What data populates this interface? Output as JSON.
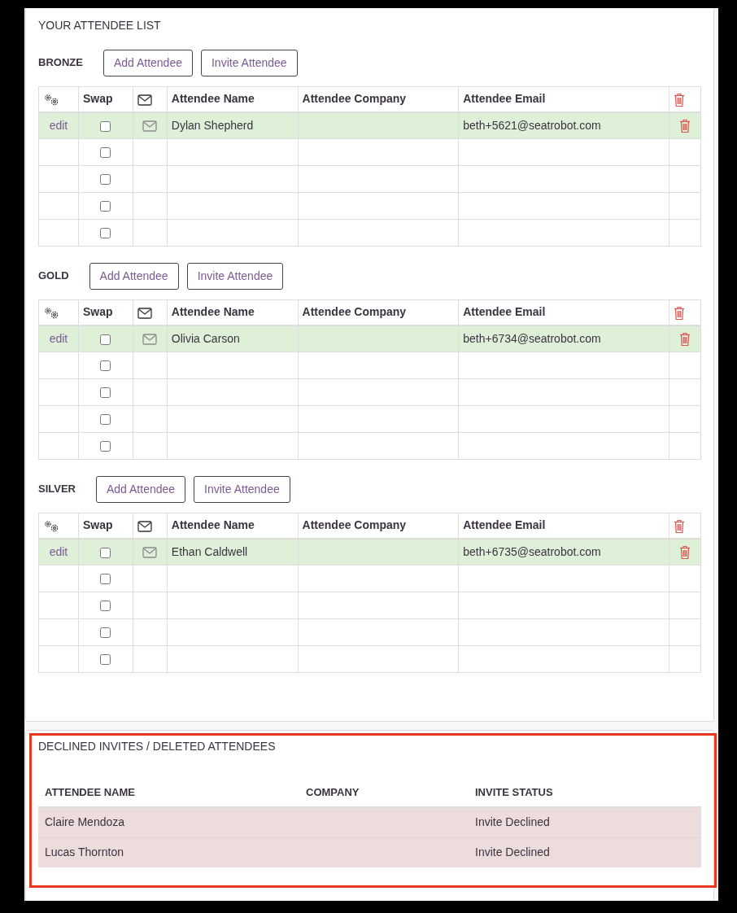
{
  "attendee_list": {
    "title": "YOUR ATTENDEE LIST",
    "sections": [
      {
        "name": "BRONZE",
        "buttons": [
          "Add Attendee",
          "Invite Attendee"
        ],
        "columns": [
          {
            "kind": "gear"
          },
          {
            "kind": "text",
            "label": "Swap"
          },
          {
            "kind": "mail"
          },
          {
            "kind": "text",
            "label": "Attendee Name"
          },
          {
            "kind": "text",
            "label": "Attendee Company"
          },
          {
            "kind": "text",
            "label": "Attendee Email"
          },
          {
            "kind": "trash"
          }
        ],
        "rows": [
          {
            "kind": "attendee",
            "action": "edit",
            "checked": false,
            "name": "Dylan Shepherd",
            "email": "beth+5621@seatrobot.com"
          },
          {
            "kind": "empty",
            "checked": false
          },
          {
            "kind": "empty",
            "checked": false
          },
          {
            "kind": "empty",
            "checked": false
          },
          {
            "kind": "empty",
            "checked": false
          }
        ]
      },
      {
        "name": "GOLD",
        "buttons": [
          "Add Attendee",
          "Invite Attendee"
        ],
        "columns": [
          {
            "kind": "gear"
          },
          {
            "kind": "text",
            "label": "Swap"
          },
          {
            "kind": "mail"
          },
          {
            "kind": "text",
            "label": "Attendee Name"
          },
          {
            "kind": "text",
            "label": "Attendee Company"
          },
          {
            "kind": "text",
            "label": "Attendee Email"
          },
          {
            "kind": "trash"
          }
        ],
        "rows": [
          {
            "kind": "attendee",
            "action": "edit",
            "checked": false,
            "name": "Olivia Carson",
            "email": "beth+6734@seatrobot.com"
          },
          {
            "kind": "empty",
            "checked": false
          },
          {
            "kind": "empty",
            "checked": false
          },
          {
            "kind": "empty",
            "checked": false
          },
          {
            "kind": "empty",
            "checked": false
          }
        ]
      },
      {
        "name": "SILVER",
        "buttons": [
          "Add Attendee",
          "Invite Attendee"
        ],
        "columns": [
          {
            "kind": "gear"
          },
          {
            "kind": "text",
            "label": "Swap"
          },
          {
            "kind": "mail"
          },
          {
            "kind": "text",
            "label": "Attendee Name"
          },
          {
            "kind": "text",
            "label": "Attendee Company"
          },
          {
            "kind": "text",
            "label": "Attendee Email"
          },
          {
            "kind": "trash"
          }
        ],
        "rows": [
          {
            "kind": "attendee",
            "action": "edit",
            "checked": false,
            "name": "Ethan Caldwell",
            "email": "beth+6735@seatrobot.com"
          },
          {
            "kind": "empty",
            "checked": false
          },
          {
            "kind": "empty",
            "checked": false
          },
          {
            "kind": "empty",
            "checked": false
          },
          {
            "kind": "empty",
            "checked": false
          }
        ]
      }
    ]
  },
  "declined": {
    "title": "DECLINED INVITES / DELETED ATTENDEES",
    "highlighted": true,
    "columns": [
      "ATTENDEE NAME",
      "COMPANY",
      "INVITE STATUS"
    ],
    "rows": [
      {
        "name": "Claire Mendoza",
        "status": "Invite Declined"
      },
      {
        "name": "Lucas Thornton",
        "status": "Invite Declined"
      }
    ]
  }
}
